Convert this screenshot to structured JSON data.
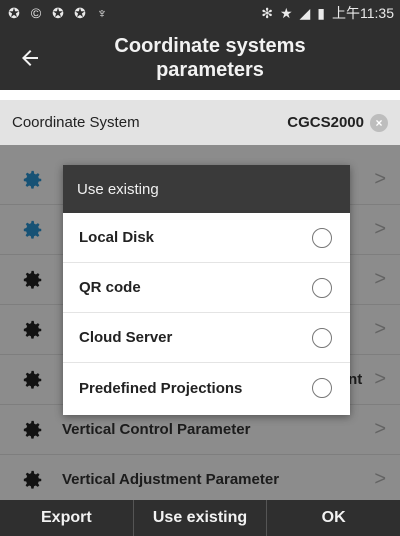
{
  "status_bar": {
    "left_icons": [
      "app-icon-1",
      "app-icon-2",
      "app-icon-3",
      "app-icon-4",
      "usb-icon"
    ],
    "right_icons": [
      "bluetooth-icon",
      "star-icon",
      "signal-icon",
      "battery-icon"
    ],
    "time": "上午11:35"
  },
  "header": {
    "title": "Coordinate systems parameters",
    "back_icon": "arrow-left-icon"
  },
  "coordinate_system": {
    "label": "Coordinate System",
    "value": "CGCS2000",
    "clear_icon": "clear-circle-icon"
  },
  "list": {
    "items": [
      {
        "label": "",
        "icon_color": "#2b95d6"
      },
      {
        "label": "",
        "icon_color": "#2b95d6"
      },
      {
        "label": "",
        "icon_color": "#222222"
      },
      {
        "label": "",
        "icon_color": "#222222"
      },
      {
        "label": "nt",
        "icon_color": "#222222"
      },
      {
        "label": "Vertical Control Parameter",
        "icon_color": "#222222"
      },
      {
        "label": "Vertical Adjustment Parameter",
        "icon_color": "#222222"
      }
    ]
  },
  "dialog": {
    "title": "Use existing",
    "options": [
      {
        "label": "Local Disk",
        "selected": false
      },
      {
        "label": "QR code",
        "selected": false
      },
      {
        "label": "Cloud Server",
        "selected": false
      },
      {
        "label": "Predefined Projections",
        "selected": false
      }
    ]
  },
  "bottom_bar": {
    "export_label": "Export",
    "use_existing_label": "Use existing",
    "ok_label": "OK"
  }
}
